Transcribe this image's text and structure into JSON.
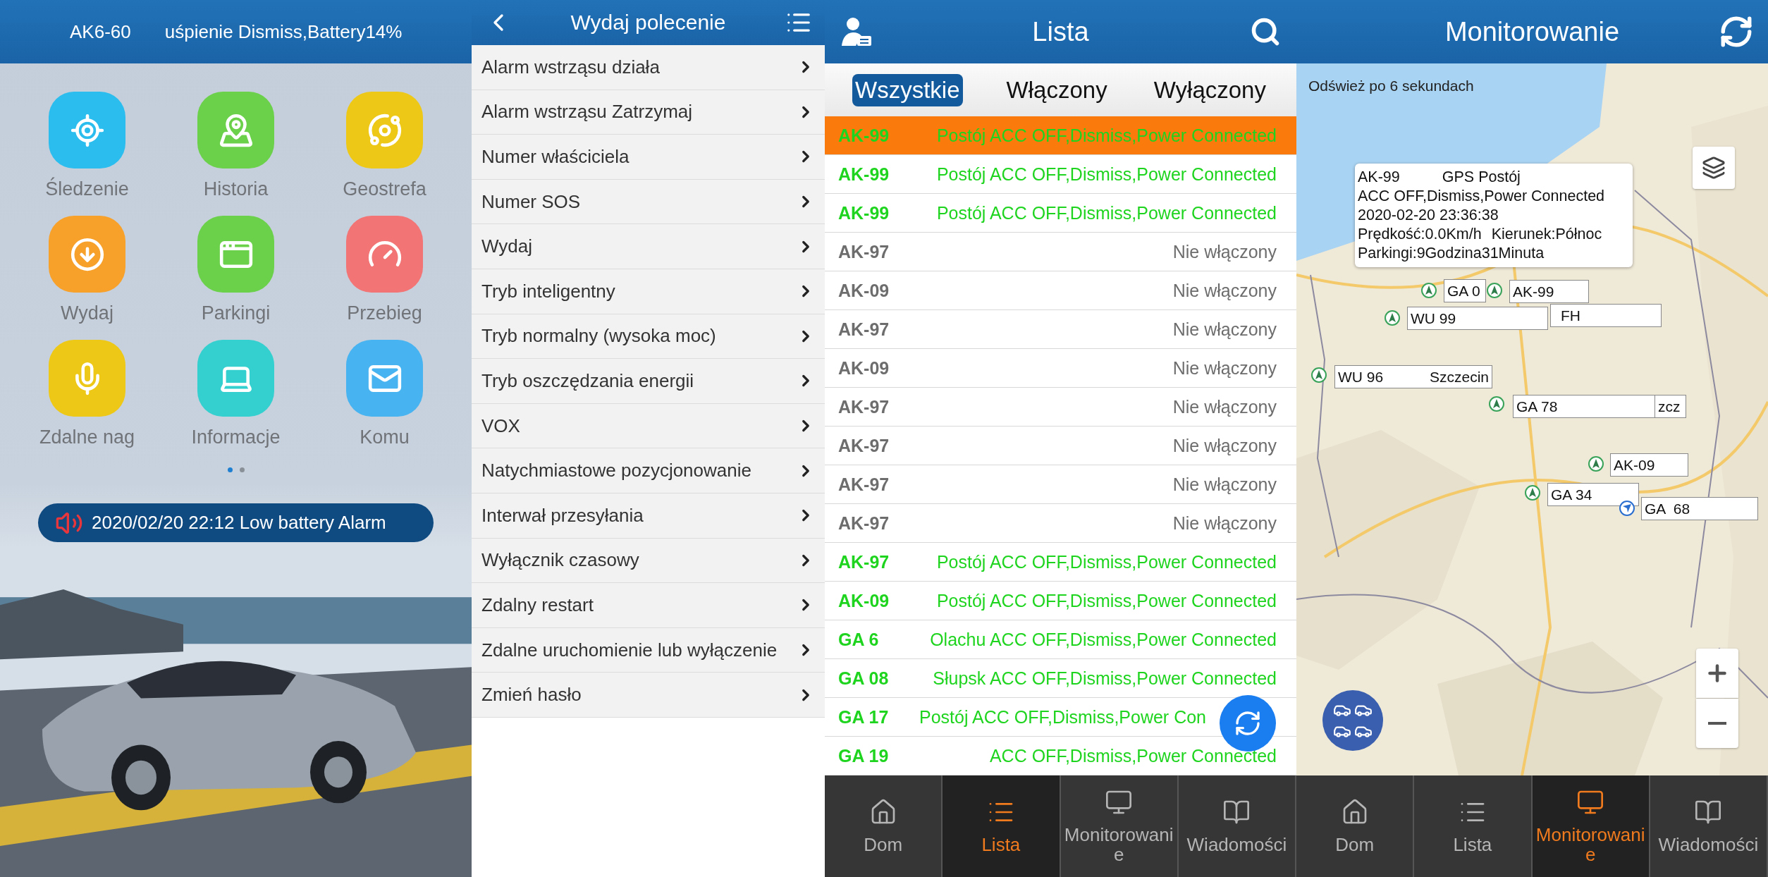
{
  "home": {
    "header": {
      "device": "AK6-60",
      "status": "uśpienie Dismiss,Battery14%"
    },
    "apps": [
      {
        "label": "Śledzenie",
        "color": "#2bbdee"
      },
      {
        "label": "Historia",
        "color": "#6cd14a"
      },
      {
        "label": "Geostrefa",
        "color": "#eec816"
      },
      {
        "label": "Wydaj",
        "color": "#f7a12a"
      },
      {
        "label": "Parkingi",
        "color": "#6cd14a"
      },
      {
        "label": "Przebieg",
        "color": "#f27474"
      },
      {
        "label": "Zdalne nag",
        "color": "#eec816"
      },
      {
        "label": "Informacje",
        "color": "#33d0cf"
      },
      {
        "label": "Komu",
        "color": "#47b3f0"
      }
    ],
    "pager": [
      {
        "selected": true
      },
      {
        "selected": false
      }
    ],
    "alert": "2020/02/20 22:12 Low battery Alarm"
  },
  "commands": {
    "title": "Wydaj polecenie",
    "items": [
      "Alarm wstrząsu działa",
      "Alarm wstrząsu Zatrzymaj",
      "Numer właściciela",
      "Numer SOS",
      "Wydaj",
      "Tryb inteligentny",
      "Tryb normalny (wysoka moc)",
      "Tryb oszczędzania energii",
      "VOX",
      "Natychmiastowe pozycjonowanie",
      "Interwał przesyłania",
      "Wyłącznik czasowy",
      "Zdalny restart",
      "Zdalne uruchomienie lub wyłączenie",
      "Zmień hasło"
    ]
  },
  "list": {
    "title": "Lista",
    "filters": [
      {
        "label": "Wszystkie",
        "selected": true
      },
      {
        "label": "Włączony",
        "selected": false
      },
      {
        "label": "Wyłączony",
        "selected": false
      }
    ],
    "rows": [
      {
        "name": "AK-99",
        "status": "Postój ACC OFF,Dismiss,Power Connected",
        "online": true,
        "selected": true
      },
      {
        "name": "AK-99",
        "status": "Postój ACC OFF,Dismiss,Power Connected",
        "online": true,
        "selected": false
      },
      {
        "name": "AK-99",
        "status": "Postój ACC OFF,Dismiss,Power Connected",
        "online": true,
        "selected": false
      },
      {
        "name": "AK-97",
        "status": "Nie włączony",
        "online": false,
        "selected": false
      },
      {
        "name": "AK-09",
        "status": "Nie włączony",
        "online": false,
        "selected": false
      },
      {
        "name": "AK-97",
        "status": "Nie włączony",
        "online": false,
        "selected": false
      },
      {
        "name": "AK-09",
        "status": "Nie włączony",
        "online": false,
        "selected": false
      },
      {
        "name": "AK-97",
        "status": "Nie włączony",
        "online": false,
        "selected": false
      },
      {
        "name": "AK-97",
        "status": "Nie włączony",
        "online": false,
        "selected": false
      },
      {
        "name": "AK-97",
        "status": "Nie włączony",
        "online": false,
        "selected": false
      },
      {
        "name": "AK-97",
        "status": "Nie włączony",
        "online": false,
        "selected": false
      },
      {
        "name": "AK-97",
        "status": "Postój ACC OFF,Dismiss,Power Connected",
        "online": true,
        "selected": false
      },
      {
        "name": "AK-09",
        "status": "Postój ACC OFF,Dismiss,Power Connected",
        "online": true,
        "selected": false
      },
      {
        "name": "GA 6",
        "status": "Olachu ACC OFF,Dismiss,Power Connected",
        "online": true,
        "selected": false
      },
      {
        "name": "GA 08",
        "status": "Słupsk ACC OFF,Dismiss,Power Connected",
        "online": true,
        "selected": false
      },
      {
        "name": "GA 17",
        "status": "Postój ACC OFF,Dismiss,Power Con",
        "online": true,
        "selected": false
      },
      {
        "name": "GA 19",
        "status": "ACC OFF,Dismiss,Power Connected",
        "online": true,
        "selected": false
      }
    ],
    "nav": [
      {
        "label": "Dom",
        "selected": false
      },
      {
        "label": "Lista",
        "selected": true
      },
      {
        "label": "Monitorowanie",
        "selected": false
      },
      {
        "label": "Wiadomości",
        "selected": false
      }
    ]
  },
  "monitor": {
    "title": "Monitorowanie",
    "refresh_note": "Odśwież po 6 sekundach",
    "info": [
      [
        "AK-99",
        "GPS Postój"
      ],
      [
        "ACC OFF,Dismiss,Power Connected"
      ],
      [
        "2020-02-20 23:36:38"
      ],
      [
        "Prędkość:0.0Km/h",
        "Kierunek:Północ"
      ],
      [
        "Parkingi:9Godzina31Minuta"
      ]
    ],
    "markers": [
      {
        "label": "GA 0"
      },
      {
        "label": "AK-99"
      },
      {
        "label": "FH"
      },
      {
        "label": "WU 99"
      },
      {
        "label": "WU 96",
        "place": "Szczecin"
      },
      {
        "label": "GA 78"
      },
      {
        "label": "zcz"
      },
      {
        "label": "AK-09"
      },
      {
        "label": "GA 34"
      },
      {
        "label": "GA  68"
      }
    ],
    "nav": [
      {
        "label": "Dom",
        "selected": false
      },
      {
        "label": "Lista",
        "selected": false
      },
      {
        "label": "Monitorowanie",
        "selected": true
      },
      {
        "label": "Wiadomości",
        "selected": false
      }
    ]
  }
}
